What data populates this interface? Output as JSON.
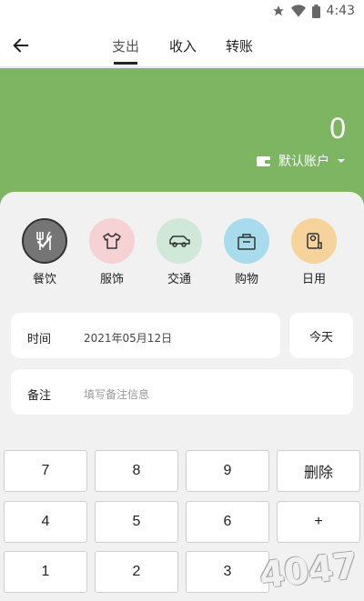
{
  "status_bar": {
    "time": "4:43"
  },
  "tabs": [
    {
      "label": "支出"
    },
    {
      "label": "收入"
    },
    {
      "label": "转账"
    }
  ],
  "header": {
    "amount": "0",
    "account": "默认账户",
    "color": "#7db563"
  },
  "categories": [
    {
      "label": "餐饮",
      "icon": "fork-knife-icon",
      "color": "#757575"
    },
    {
      "label": "服饰",
      "icon": "shirt-icon",
      "color": "#f7d2d5"
    },
    {
      "label": "交通",
      "icon": "car-icon",
      "color": "#cfe8d7"
    },
    {
      "label": "购物",
      "icon": "shopping-bag-icon",
      "color": "#a8dcec"
    },
    {
      "label": "日用",
      "icon": "toilet-paper-icon",
      "color": "#f7d39c"
    }
  ],
  "time_field": {
    "label": "时间",
    "value": "2021年05月12日",
    "today_button": "今天"
  },
  "note_field": {
    "label": "备注",
    "placeholder": "填写备注信息"
  },
  "keypad": {
    "row1": [
      "7",
      "8",
      "9",
      "删除"
    ],
    "row2": [
      "4",
      "5",
      "6",
      "+"
    ],
    "row3": [
      "1",
      "2",
      "3"
    ]
  },
  "watermark": "4047"
}
